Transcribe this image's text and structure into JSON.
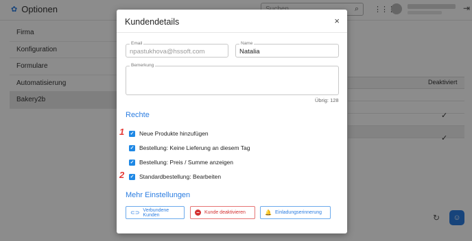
{
  "app": {
    "title": "Optionen",
    "search_placeholder": "Suchen",
    "sidebar": [
      "Firma",
      "Konfiguration",
      "Formulare",
      "Automatisierung",
      "Bakery2b"
    ],
    "table_column_deaktiviert": "Deaktiviert",
    "check_glyph": "✓"
  },
  "modal": {
    "title": "Kundendetails",
    "close_glyph": "×",
    "email": {
      "label": "Email",
      "value": "npastukhova@hssoft.com"
    },
    "name": {
      "label": "Name",
      "value": "Natalia"
    },
    "bemerkung": {
      "label": "Bemerkung",
      "value": "",
      "counter": "Übrig: 128"
    },
    "rechte_title": "Rechte",
    "permissions": [
      {
        "label": "Neue Produkte hinzufügen",
        "checked": true
      },
      {
        "label": "Bestellung: Keine Lieferung an diesem Tag",
        "checked": true
      },
      {
        "label": "Bestellung: Preis / Summe anzeigen",
        "checked": true
      },
      {
        "label": "Standardbestellung: Bearbeiten",
        "checked": true
      }
    ],
    "markers": [
      "1",
      "2"
    ],
    "mehr_title": "Mehr Einstellungen",
    "buttons": {
      "linked": "Verbundene Kunden",
      "deactivate": "Kunde deaktivieren",
      "invite": "Einladungserinnerung"
    }
  },
  "icons": {
    "settings": "settings-icon",
    "search": "search-icon",
    "apps": "apps-grid-icon",
    "logout": "logout-icon",
    "close": "close-icon",
    "link": "link-icon",
    "deactivate": "minus-circle-icon",
    "bell": "bell-icon",
    "refresh": "refresh-icon",
    "chat": "chat-bot-icon"
  },
  "colors": {
    "accent": "#2b7de1",
    "danger": "#d32f2f",
    "checkbox": "#1e88e5",
    "marker": "#e53935"
  }
}
